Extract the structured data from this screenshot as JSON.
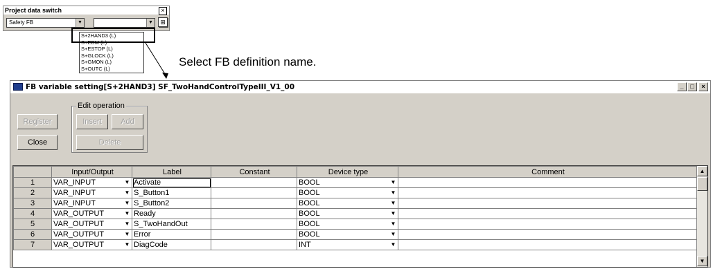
{
  "switch_window": {
    "title": "Project data switch",
    "close_glyph": "×",
    "category_value": "Safety FB",
    "fb_list": [
      "S+2HAND3 (L)",
      "S+EDM (L)",
      "S+ESTOP (L)",
      "S+GLOCK (L)",
      "S+GMON (L)",
      "S+OUTC (L)"
    ]
  },
  "callout": "Select FB definition name.",
  "window": {
    "title": "FB variable setting[S+2HAND3]  SF_TwoHandControlTypeIII_V1_00",
    "min_glyph": "_",
    "max_glyph": "□",
    "close_glyph": "×",
    "register_label": "Register",
    "close_label": "Close",
    "edit_group_label": "Edit operation",
    "insert_label": "Insert",
    "add_label": "Add",
    "delete_label": "Delete"
  },
  "grid": {
    "headers": [
      "",
      "Input/Output",
      "Label",
      "Constant",
      "Device type",
      "Comment"
    ],
    "rows": [
      {
        "num": "1",
        "io": "VAR_INPUT",
        "label": "Activate",
        "constant": "",
        "device": "BOOL",
        "comment": ""
      },
      {
        "num": "2",
        "io": "VAR_INPUT",
        "label": "S_Button1",
        "constant": "",
        "device": "BOOL",
        "comment": ""
      },
      {
        "num": "3",
        "io": "VAR_INPUT",
        "label": "S_Button2",
        "constant": "",
        "device": "BOOL",
        "comment": ""
      },
      {
        "num": "4",
        "io": "VAR_OUTPUT",
        "label": "Ready",
        "constant": "",
        "device": "BOOL",
        "comment": ""
      },
      {
        "num": "5",
        "io": "VAR_OUTPUT",
        "label": "S_TwoHandOut",
        "constant": "",
        "device": "BOOL",
        "comment": ""
      },
      {
        "num": "6",
        "io": "VAR_OUTPUT",
        "label": "Error",
        "constant": "",
        "device": "BOOL",
        "comment": ""
      },
      {
        "num": "7",
        "io": "VAR_OUTPUT",
        "label": "DiagCode",
        "constant": "",
        "device": "INT",
        "comment": ""
      }
    ]
  }
}
